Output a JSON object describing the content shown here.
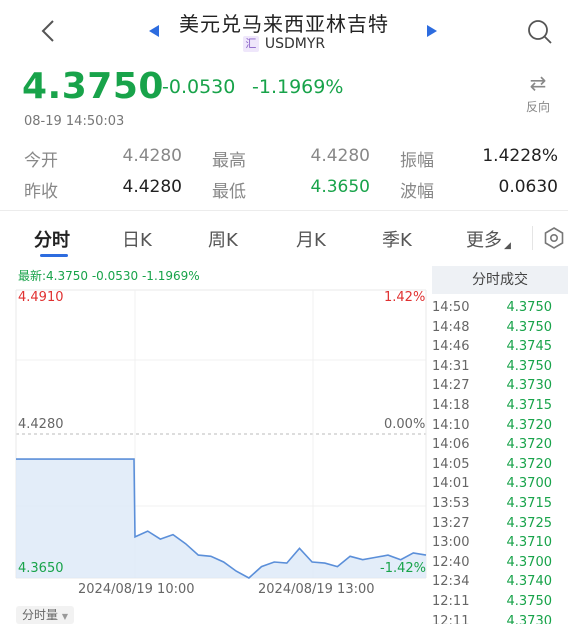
{
  "header": {
    "title": "美元兑马来西亚林吉特",
    "symbol_badge": "汇",
    "symbol": "USDMYR"
  },
  "quote": {
    "price": "4.3750",
    "change": "-0.0530",
    "change_pct": "-1.1969%",
    "timestamp": "08-19 14:50:03",
    "swap_label": "反向"
  },
  "stats": {
    "open_label": "今开",
    "open_value": "4.4280",
    "high_label": "最高",
    "high_value": "4.4280",
    "amplitude_label": "振幅",
    "amplitude_value": "1.4228%",
    "prev_close_label": "昨收",
    "prev_close_value": "4.4280",
    "low_label": "最低",
    "low_value": "4.3650",
    "spread_label": "波幅",
    "spread_value": "0.0630"
  },
  "tabs": {
    "intraday": "分时",
    "daily": "日K",
    "weekly": "周K",
    "monthly": "月K",
    "quarterly": "季K",
    "more": "更多"
  },
  "chart": {
    "info_line": "最新:4.3750  -0.0530  -1.1969%",
    "y_top": "4.4910",
    "y_mid": "4.4280",
    "y_bottom": "4.3650",
    "pct_top": "1.42%",
    "pct_mid": "0.00%",
    "pct_bottom": "-1.42%",
    "x_left": "2024/08/19 10:00",
    "x_right": "2024/08/19 13:00",
    "volume_tag": "分时量"
  },
  "chart_data": {
    "type": "line",
    "title": "",
    "xlabel": "",
    "ylabel": "",
    "ylim": [
      4.365,
      4.491
    ],
    "x_ticks": [
      "2024/08/19 10:00",
      "2024/08/19 13:00"
    ],
    "series": [
      {
        "values": [
          4.417,
          4.417,
          4.417,
          4.417,
          4.417,
          4.417,
          4.417,
          4.383,
          4.3855,
          4.382,
          4.384,
          4.38,
          4.375,
          4.3745,
          4.372,
          4.368,
          4.365,
          4.37,
          4.372,
          4.3715,
          4.378,
          4.372,
          4.3715,
          4.37,
          4.3745,
          4.373,
          4.374,
          4.375,
          4.373,
          4.376,
          4.375
        ]
      }
    ]
  },
  "trades": {
    "header": "分时成交",
    "rows": [
      {
        "time": "14:50",
        "price": "4.3750"
      },
      {
        "time": "14:48",
        "price": "4.3750"
      },
      {
        "time": "14:46",
        "price": "4.3745"
      },
      {
        "time": "14:31",
        "price": "4.3750"
      },
      {
        "time": "14:27",
        "price": "4.3730"
      },
      {
        "time": "14:18",
        "price": "4.3715"
      },
      {
        "time": "14:10",
        "price": "4.3720"
      },
      {
        "time": "14:06",
        "price": "4.3720"
      },
      {
        "time": "14:05",
        "price": "4.3720"
      },
      {
        "time": "14:01",
        "price": "4.3700"
      },
      {
        "time": "13:53",
        "price": "4.3715"
      },
      {
        "time": "13:27",
        "price": "4.3725"
      },
      {
        "time": "13:00",
        "price": "4.3710"
      },
      {
        "time": "12:40",
        "price": "4.3700"
      },
      {
        "time": "12:34",
        "price": "4.3740"
      },
      {
        "time": "12:11",
        "price": "4.3750"
      },
      {
        "time": "12:11",
        "price": "4.3730"
      }
    ]
  },
  "colors": {
    "down_green": "#18a34a",
    "up_red": "#e03131",
    "tab_accent": "#2d6cdf",
    "line_blue": "#5b8fd9"
  }
}
